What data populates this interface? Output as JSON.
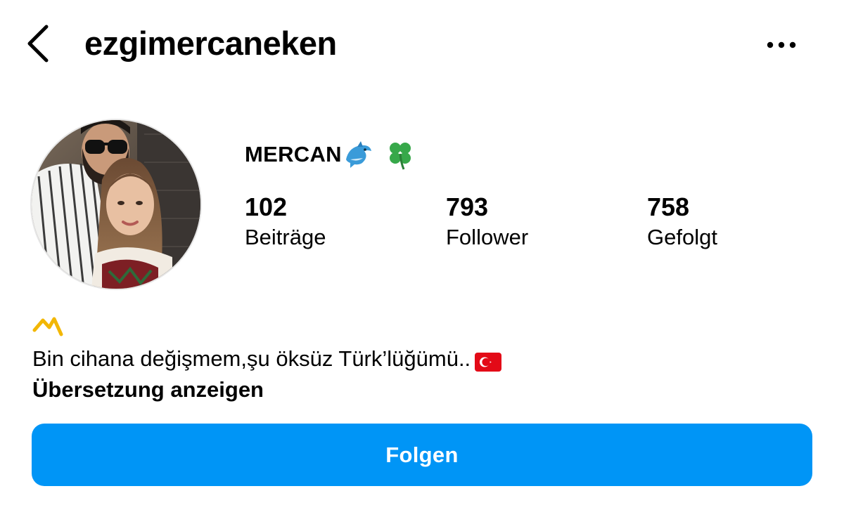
{
  "header": {
    "username": "ezgimercaneken",
    "back_icon": "chevron-left-icon",
    "more_icon": "more-horizontal-icon"
  },
  "profile": {
    "display_name": "MERCAN",
    "display_name_emojis": [
      "dolphin-emoji",
      "four-leaf-clover-emoji"
    ],
    "stats": [
      {
        "value": "102",
        "label": "Beiträge"
      },
      {
        "value": "793",
        "label": "Follower"
      },
      {
        "value": "758",
        "label": "Gefolgt"
      }
    ]
  },
  "bio": {
    "mark_icon": "yellow-caret-symbol",
    "text": "Bin cihana değişmem,şu öksüz Türk’lüğümü..",
    "flag_icon": "turkey-flag-emoji",
    "translate_label": "Übersetzung anzeigen"
  },
  "actions": {
    "follow_label": "Folgen"
  },
  "colors": {
    "follow_button": "#0095f6",
    "follow_text": "#ffffff",
    "text": "#000000",
    "bio_mark": "#f2b705",
    "flag_red": "#e30a17"
  }
}
